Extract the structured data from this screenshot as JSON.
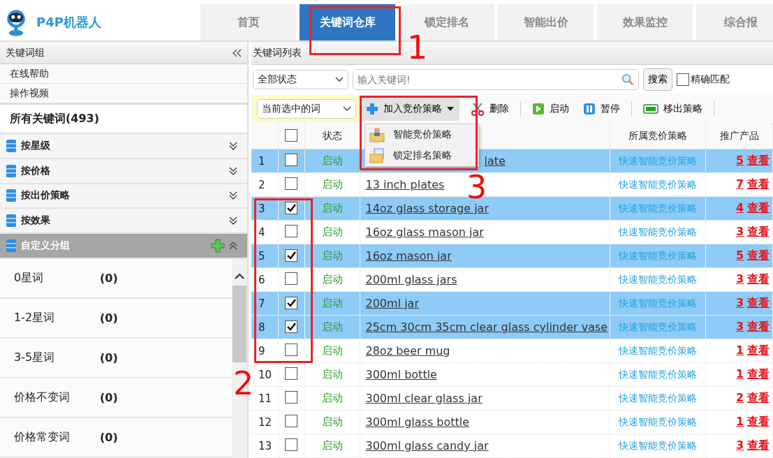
{
  "app": {
    "name": "P4P机器人"
  },
  "tabs": [
    {
      "label": "首页",
      "selected": false
    },
    {
      "label": "关键词仓库",
      "selected": true
    },
    {
      "label": "锁定排名",
      "selected": false
    },
    {
      "label": "智能出价",
      "selected": false
    },
    {
      "label": "效果监控",
      "selected": false
    },
    {
      "label": "综合报",
      "selected": false
    }
  ],
  "sidebar": {
    "title": "关键词组",
    "links": [
      "在线帮助",
      "操作视频"
    ],
    "all_keywords": "所有关键词(493)",
    "groups": [
      {
        "label": "按星级",
        "expanded": false,
        "addable": false
      },
      {
        "label": "按价格",
        "expanded": false,
        "addable": false
      },
      {
        "label": "按出价策略",
        "expanded": false,
        "addable": false
      },
      {
        "label": "按效果",
        "expanded": false,
        "addable": false
      },
      {
        "label": "自定义分组",
        "expanded": true,
        "addable": true
      }
    ],
    "items": [
      {
        "label": "0星词",
        "count": "(0)"
      },
      {
        "label": "1-2星词",
        "count": "(0)"
      },
      {
        "label": "3-5星词",
        "count": "(0)"
      },
      {
        "label": "价格不变词",
        "count": "(0)"
      },
      {
        "label": "价格常变词",
        "count": "(0)"
      }
    ]
  },
  "panel": {
    "title": "关键词列表",
    "status_filter": "全部状态",
    "search": {
      "placeholder": "输入关键词!"
    },
    "search_button": "搜索",
    "exact_match": {
      "label": "精确匹配",
      "checked": false
    },
    "scope": "当前选中的词",
    "toolbar": [
      {
        "kind": "add",
        "label": "加入竞价策略"
      },
      {
        "kind": "delete",
        "label": "删除"
      },
      {
        "kind": "start",
        "label": "启动"
      },
      {
        "kind": "pause",
        "label": "暂停"
      },
      {
        "kind": "remove",
        "label": "移出策略"
      }
    ],
    "menu": [
      {
        "kind": "smart",
        "label": "智能竞价策略"
      },
      {
        "kind": "lock",
        "label": "锁定排名策略"
      }
    ],
    "table": {
      "columns": [
        "状态",
        "所属竞价策略",
        "推广产品"
      ],
      "select_all_checked": false,
      "rows": [
        {
          "no": "1",
          "checked": false,
          "selected": true,
          "status": "启动",
          "keyword": "late",
          "covered": true,
          "strategy": "快速智能竞价策略",
          "count": "5",
          "view": "查看"
        },
        {
          "no": "2",
          "checked": false,
          "selected": false,
          "status": "启动",
          "keyword": "13 inch plates",
          "covered": false,
          "strategy": "快速智能竞价策略",
          "count": "7",
          "view": "查看"
        },
        {
          "no": "3",
          "checked": true,
          "selected": true,
          "status": "启动",
          "keyword": "14oz glass storage jar",
          "covered": false,
          "strategy": "快速智能竞价策略",
          "count": "4",
          "view": "查看"
        },
        {
          "no": "4",
          "checked": false,
          "selected": false,
          "status": "启动",
          "keyword": "16oz glass mason jar",
          "covered": false,
          "strategy": "快速智能竞价策略",
          "count": "3",
          "view": "查看"
        },
        {
          "no": "5",
          "checked": true,
          "selected": true,
          "status": "启动",
          "keyword": "16oz mason jar",
          "covered": false,
          "strategy": "快速智能竞价策略",
          "count": "5",
          "view": "查看"
        },
        {
          "no": "6",
          "checked": false,
          "selected": false,
          "status": "启动",
          "keyword": "200ml glass jars",
          "covered": false,
          "strategy": "快速智能竞价策略",
          "count": "3",
          "view": "查看"
        },
        {
          "no": "7",
          "checked": true,
          "selected": true,
          "status": "启动",
          "keyword": "200ml jar",
          "covered": false,
          "strategy": "快速智能竞价策略",
          "count": "3",
          "view": "查看"
        },
        {
          "no": "8",
          "checked": true,
          "selected": true,
          "status": "启动",
          "keyword": "25cm 30cm 35cm clear glass cylinder vase",
          "covered": false,
          "strategy": "快速智能竞价策略",
          "count": "3",
          "view": "查看"
        },
        {
          "no": "9",
          "checked": false,
          "selected": false,
          "status": "启动",
          "keyword": "28oz beer mug",
          "covered": false,
          "strategy": "快速智能竞价策略",
          "count": "1",
          "view": "查看"
        },
        {
          "no": "10",
          "checked": false,
          "selected": false,
          "status": "启动",
          "keyword": "300ml bottle",
          "covered": false,
          "strategy": "快速智能竞价策略",
          "count": "1",
          "view": "查看"
        },
        {
          "no": "11",
          "checked": false,
          "selected": false,
          "status": "启动",
          "keyword": "300ml clear glass jar",
          "covered": false,
          "strategy": "快速智能竞价策略",
          "count": "2",
          "view": "查看"
        },
        {
          "no": "12",
          "checked": false,
          "selected": false,
          "status": "启动",
          "keyword": "300ml glass bottle",
          "covered": false,
          "strategy": "快速智能竞价策略",
          "count": "1",
          "view": "查看"
        },
        {
          "no": "13",
          "checked": false,
          "selected": false,
          "status": "启动",
          "keyword": "300ml glass candy jar",
          "covered": false,
          "strategy": "快速智能竞价策略",
          "count": "3",
          "view": "查看"
        }
      ]
    }
  },
  "annotations": [
    {
      "kind": "tab",
      "label": "1"
    },
    {
      "kind": "checkboxes",
      "label": "2"
    },
    {
      "kind": "menu",
      "label": "3"
    }
  ]
}
